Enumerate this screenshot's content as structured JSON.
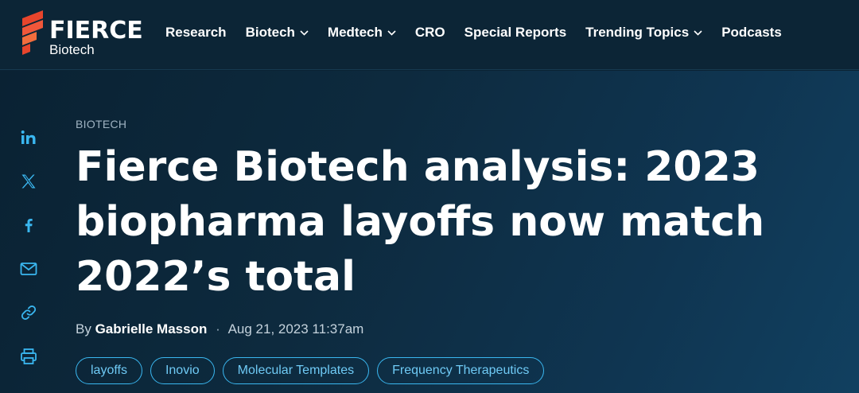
{
  "brand": {
    "word": "FIERCE",
    "sub": "Biotech",
    "colors": {
      "primary": "#e8452c",
      "secondary": "#f26d3d"
    }
  },
  "nav": {
    "items": [
      {
        "label": "Research",
        "dropdown": false
      },
      {
        "label": "Biotech",
        "dropdown": true
      },
      {
        "label": "Medtech",
        "dropdown": true
      },
      {
        "label": "CRO",
        "dropdown": false
      },
      {
        "label": "Special Reports",
        "dropdown": false
      },
      {
        "label": "Trending Topics",
        "dropdown": true
      },
      {
        "label": "Podcasts",
        "dropdown": false
      }
    ]
  },
  "share": {
    "icons": [
      "linkedin-icon",
      "x-icon",
      "facebook-icon",
      "email-icon",
      "link-icon",
      "print-icon"
    ]
  },
  "article": {
    "kicker": "BIOTECH",
    "headline_lines": [
      "Fierce Biotech analysis: 2023",
      "biopharma layoffs now match",
      "2022’s total"
    ],
    "byline_prefix": "By",
    "author": "Gabrielle Masson",
    "separator": "·",
    "date": "Aug 21, 2023 11:37am",
    "tags": [
      "layoffs",
      "Inovio",
      "Molecular Templates",
      "Frequency Therapeutics"
    ]
  },
  "colors": {
    "background": "#0a2233",
    "tag_accent": "#3ab7f0",
    "muted_text": "#9fb3c2"
  }
}
